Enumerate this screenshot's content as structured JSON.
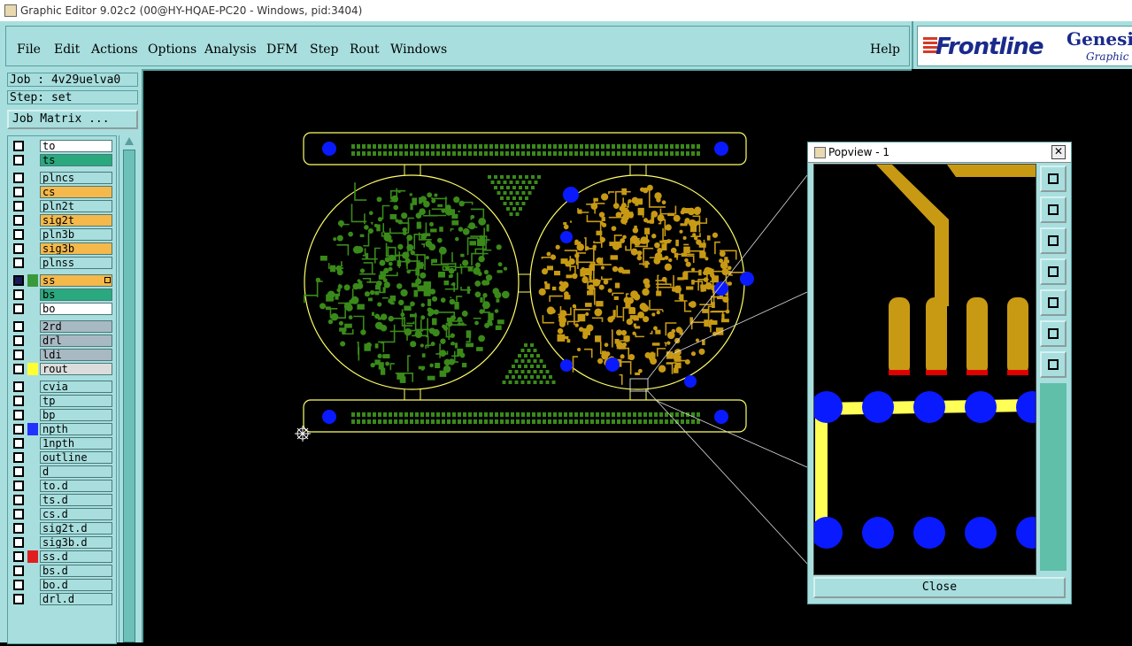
{
  "window": {
    "title": "Graphic Editor 9.02c2 (00@HY-HQAE-PC20 - Windows, pid:3404)"
  },
  "menu": {
    "file": "File",
    "edit": "Edit",
    "actions": "Actions",
    "options": "Options",
    "analysis": "Analysis",
    "dfm": "DFM",
    "step": "Step",
    "rout": "Rout",
    "windows": "Windows",
    "help": "Help"
  },
  "brand": {
    "logo": "Frontline",
    "product": "Genesis",
    "subtitle": "Graphic E"
  },
  "job": {
    "label": "Job : 4v29uelva0",
    "step": "Step: set",
    "matrix_button": "Job Matrix ..."
  },
  "layers": [
    {
      "name": "to",
      "color": "#ffffff"
    },
    {
      "name": "ts",
      "color": "#2aa87e"
    },
    {
      "name": "plncs",
      "color": "#a8dede"
    },
    {
      "name": "cs",
      "color": "#f5b84a"
    },
    {
      "name": "pln2t",
      "color": "#a8dede"
    },
    {
      "name": "sig2t",
      "color": "#f5b84a"
    },
    {
      "name": "pln3b",
      "color": "#a8dede"
    },
    {
      "name": "sig3b",
      "color": "#f5b84a"
    },
    {
      "name": "plnss",
      "color": "#a8dede"
    },
    {
      "name": "ss",
      "color": "#f5b84a",
      "swatch": "#3a9a3a",
      "active": true
    },
    {
      "name": "bs",
      "color": "#2aa87e"
    },
    {
      "name": "bo",
      "color": "#ffffff"
    },
    {
      "name": "2rd",
      "color": "#a9b9c3"
    },
    {
      "name": "drl",
      "color": "#a9b9c3"
    },
    {
      "name": "ldi",
      "color": "#a9b9c3"
    },
    {
      "name": "rout",
      "color": "#dcdcdc",
      "swatch": "#ffff33"
    },
    {
      "name": "cvia",
      "color": "#a8dede"
    },
    {
      "name": "tp",
      "color": "#a8dede"
    },
    {
      "name": "bp",
      "color": "#a8dede"
    },
    {
      "name": "npth",
      "color": "#a8dede",
      "swatch": "#2233ff"
    },
    {
      "name": "1npth",
      "color": "#a8dede"
    },
    {
      "name": "outline",
      "color": "#a8dede"
    },
    {
      "name": "d",
      "color": "#a8dede"
    },
    {
      "name": "to.d",
      "color": "#a8dede"
    },
    {
      "name": "ts.d",
      "color": "#a8dede"
    },
    {
      "name": "cs.d",
      "color": "#a8dede"
    },
    {
      "name": "sig2t.d",
      "color": "#a8dede"
    },
    {
      "name": "sig3b.d",
      "color": "#a8dede"
    },
    {
      "name": "ss.d",
      "color": "#a8dede",
      "swatch": "#e02020"
    },
    {
      "name": "bs.d",
      "color": "#a8dede"
    },
    {
      "name": "bo.d",
      "color": "#a8dede"
    },
    {
      "name": "drl.d",
      "color": "#a8dede"
    }
  ],
  "popview": {
    "title": "Popview - 1",
    "close_label": "Close"
  },
  "colors": {
    "panel": "#a8dede",
    "green_layer": "#3a8a1a",
    "gold_layer": "#c89a14",
    "outline": "#ffff66",
    "npth": "#0a1aff"
  }
}
